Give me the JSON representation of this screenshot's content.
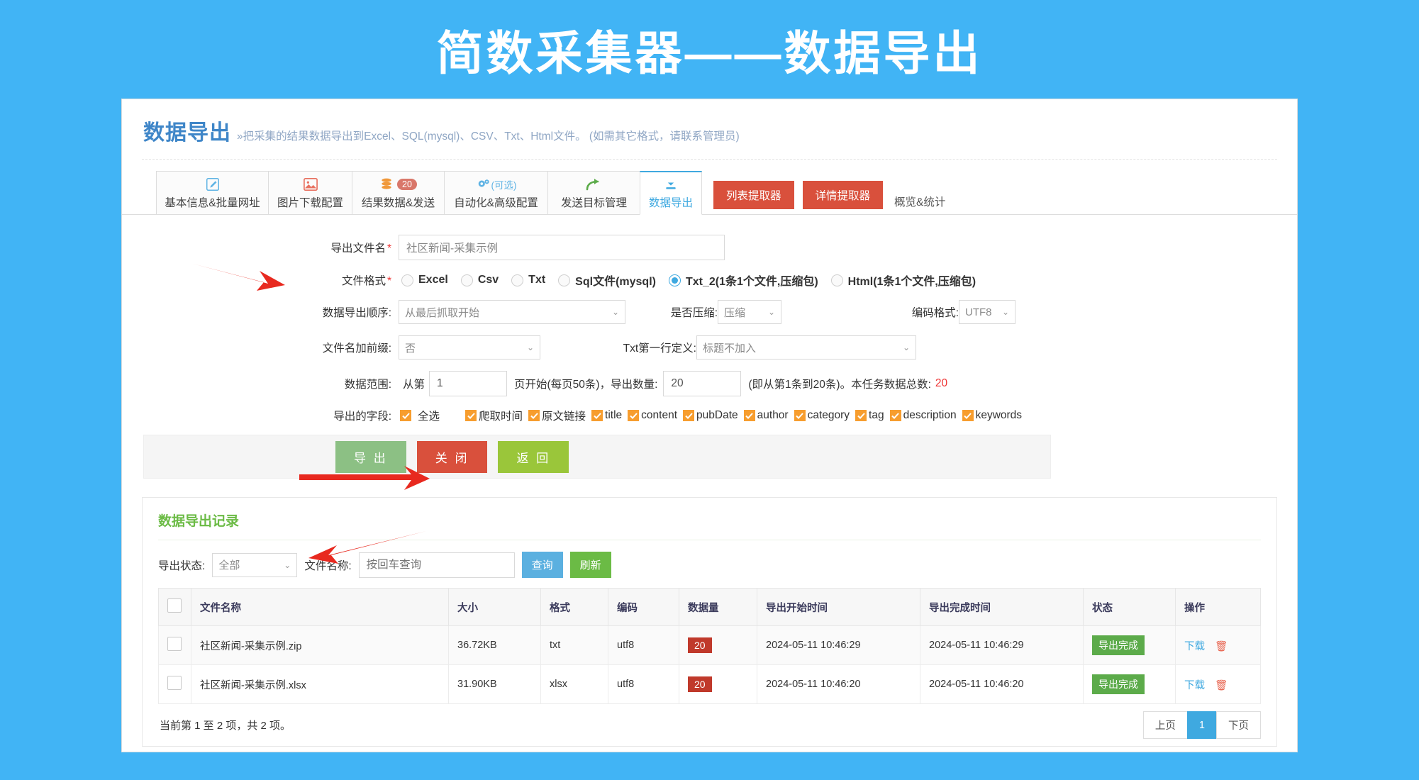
{
  "banner": {
    "title": "简数采集器——数据导出"
  },
  "header": {
    "title": "数据导出",
    "subtitle": "»把采集的结果数据导出到Excel、SQL(mysql)、CSV、Txt、Html文件。 (如需其它格式，请联系管理员)"
  },
  "tabs": [
    {
      "label": "基本信息&批量网址",
      "icon": "edit-icon",
      "badge": "",
      "note": ""
    },
    {
      "label": "图片下载配置",
      "icon": "image-icon",
      "badge": "",
      "note": ""
    },
    {
      "label": "结果数据&发送",
      "icon": "database-icon",
      "badge": "20",
      "note": ""
    },
    {
      "label": "自动化&高级配置",
      "icon": "gears-icon",
      "badge": "",
      "note": "(可选)"
    },
    {
      "label": "发送目标管理",
      "icon": "arrow-forward-icon",
      "badge": "",
      "note": ""
    },
    {
      "label": "数据导出",
      "icon": "download-icon",
      "badge": "",
      "note": "",
      "active": true
    }
  ],
  "extra_buttons": [
    {
      "label": "列表提取器"
    },
    {
      "label": "详情提取器"
    }
  ],
  "overview_link": "概览&统计",
  "form": {
    "filename": {
      "label": "导出文件名",
      "required": true,
      "value": "社区新闻-采集示例"
    },
    "format": {
      "label": "文件格式",
      "required": true,
      "options": [
        {
          "label": "Excel",
          "checked": false
        },
        {
          "label": "Csv",
          "checked": false
        },
        {
          "label": "Txt",
          "checked": false
        },
        {
          "label": "Sql文件(mysql)",
          "checked": false
        },
        {
          "label": "Txt_2(1条1个文件,压缩包)",
          "checked": true
        },
        {
          "label": "Html(1条1个文件,压缩包)",
          "checked": false
        }
      ]
    },
    "order": {
      "label": "数据导出顺序:",
      "value": "从最后抓取开始"
    },
    "compress": {
      "label": "是否压缩:",
      "value": "压缩"
    },
    "encoding": {
      "label": "编码格式:",
      "value": "UTF8"
    },
    "prefix": {
      "label": "文件名加前缀:",
      "value": "否"
    },
    "txt_first_line": {
      "label": "Txt第一行定义:",
      "value": "标题不加入"
    },
    "range": {
      "label": "数据范围:",
      "from_label": "从第",
      "page_value": "1",
      "mid_label": "页开始(每页50条)，导出数量:",
      "count_value": "20",
      "note": "(即从第1条到20条)。本任务数据总数:",
      "total": "20"
    },
    "fields": {
      "label": "导出的字段:",
      "select_all": "全选",
      "items": [
        "爬取时间",
        "原文链接",
        "title",
        "content",
        "pubDate",
        "author",
        "category",
        "tag",
        "description",
        "keywords"
      ]
    }
  },
  "actions": [
    {
      "label": "导 出",
      "color": "#8cc084"
    },
    {
      "label": "关 闭",
      "color": "#d9503c"
    },
    {
      "label": "返 回",
      "color": "#9ac63a"
    }
  ],
  "records": {
    "title": "数据导出记录",
    "filter": {
      "status_label": "导出状态:",
      "status_value": "全部",
      "filename_label": "文件名称:",
      "filename_placeholder": "按回车查询",
      "search_button": "查询",
      "refresh_button": "刷新"
    },
    "columns": [
      "文件名称",
      "大小",
      "格式",
      "编码",
      "数据量",
      "导出开始时间",
      "导出完成时间",
      "状态",
      "操作"
    ],
    "rows": [
      {
        "filename": "社区新闻-采集示例.zip",
        "size": "36.72KB",
        "format": "txt",
        "encoding": "utf8",
        "count": "20",
        "start_time": "2024-05-11 10:46:29",
        "end_time": "2024-05-11 10:46:29",
        "status": "导出完成",
        "download": "下载"
      },
      {
        "filename": "社区新闻-采集示例.xlsx",
        "size": "31.90KB",
        "format": "xlsx",
        "encoding": "utf8",
        "count": "20",
        "start_time": "2024-05-11 10:46:20",
        "end_time": "2024-05-11 10:46:20",
        "status": "导出完成",
        "download": "下载"
      }
    ],
    "summary": "当前第 1 至 2 项，共 2 项。",
    "pager": {
      "prev": "上页",
      "current": "1",
      "next": "下页"
    }
  },
  "colors": {
    "background": "#41b4f5",
    "accent": "#3fa9e0",
    "danger": "#d9503c",
    "success": "#5cab4a",
    "checkbox": "#f79d2e",
    "badge": "#c0392b"
  }
}
